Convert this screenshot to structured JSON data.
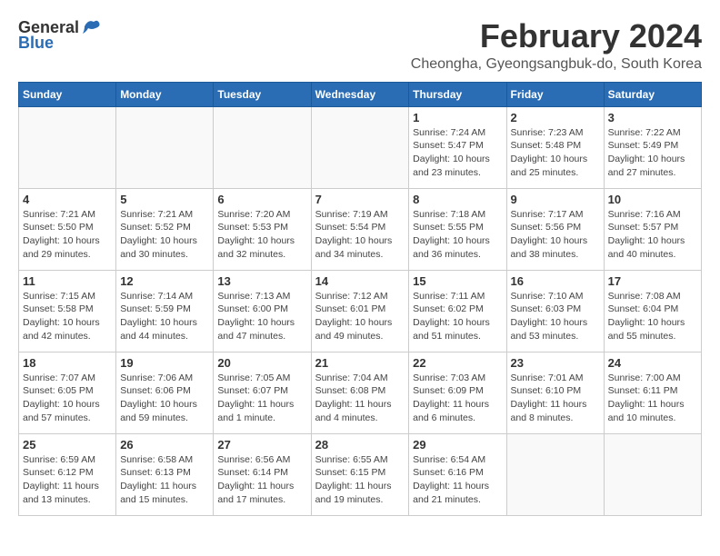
{
  "logo": {
    "general": "General",
    "blue": "Blue"
  },
  "title": {
    "month_year": "February 2024",
    "location": "Cheongha, Gyeongsangbuk-do, South Korea"
  },
  "days_of_week": [
    "Sunday",
    "Monday",
    "Tuesday",
    "Wednesday",
    "Thursday",
    "Friday",
    "Saturday"
  ],
  "weeks": [
    [
      {
        "day": "",
        "info": ""
      },
      {
        "day": "",
        "info": ""
      },
      {
        "day": "",
        "info": ""
      },
      {
        "day": "",
        "info": ""
      },
      {
        "day": "1",
        "info": "Sunrise: 7:24 AM\nSunset: 5:47 PM\nDaylight: 10 hours\nand 23 minutes."
      },
      {
        "day": "2",
        "info": "Sunrise: 7:23 AM\nSunset: 5:48 PM\nDaylight: 10 hours\nand 25 minutes."
      },
      {
        "day": "3",
        "info": "Sunrise: 7:22 AM\nSunset: 5:49 PM\nDaylight: 10 hours\nand 27 minutes."
      }
    ],
    [
      {
        "day": "4",
        "info": "Sunrise: 7:21 AM\nSunset: 5:50 PM\nDaylight: 10 hours\nand 29 minutes."
      },
      {
        "day": "5",
        "info": "Sunrise: 7:21 AM\nSunset: 5:52 PM\nDaylight: 10 hours\nand 30 minutes."
      },
      {
        "day": "6",
        "info": "Sunrise: 7:20 AM\nSunset: 5:53 PM\nDaylight: 10 hours\nand 32 minutes."
      },
      {
        "day": "7",
        "info": "Sunrise: 7:19 AM\nSunset: 5:54 PM\nDaylight: 10 hours\nand 34 minutes."
      },
      {
        "day": "8",
        "info": "Sunrise: 7:18 AM\nSunset: 5:55 PM\nDaylight: 10 hours\nand 36 minutes."
      },
      {
        "day": "9",
        "info": "Sunrise: 7:17 AM\nSunset: 5:56 PM\nDaylight: 10 hours\nand 38 minutes."
      },
      {
        "day": "10",
        "info": "Sunrise: 7:16 AM\nSunset: 5:57 PM\nDaylight: 10 hours\nand 40 minutes."
      }
    ],
    [
      {
        "day": "11",
        "info": "Sunrise: 7:15 AM\nSunset: 5:58 PM\nDaylight: 10 hours\nand 42 minutes."
      },
      {
        "day": "12",
        "info": "Sunrise: 7:14 AM\nSunset: 5:59 PM\nDaylight: 10 hours\nand 44 minutes."
      },
      {
        "day": "13",
        "info": "Sunrise: 7:13 AM\nSunset: 6:00 PM\nDaylight: 10 hours\nand 47 minutes."
      },
      {
        "day": "14",
        "info": "Sunrise: 7:12 AM\nSunset: 6:01 PM\nDaylight: 10 hours\nand 49 minutes."
      },
      {
        "day": "15",
        "info": "Sunrise: 7:11 AM\nSunset: 6:02 PM\nDaylight: 10 hours\nand 51 minutes."
      },
      {
        "day": "16",
        "info": "Sunrise: 7:10 AM\nSunset: 6:03 PM\nDaylight: 10 hours\nand 53 minutes."
      },
      {
        "day": "17",
        "info": "Sunrise: 7:08 AM\nSunset: 6:04 PM\nDaylight: 10 hours\nand 55 minutes."
      }
    ],
    [
      {
        "day": "18",
        "info": "Sunrise: 7:07 AM\nSunset: 6:05 PM\nDaylight: 10 hours\nand 57 minutes."
      },
      {
        "day": "19",
        "info": "Sunrise: 7:06 AM\nSunset: 6:06 PM\nDaylight: 10 hours\nand 59 minutes."
      },
      {
        "day": "20",
        "info": "Sunrise: 7:05 AM\nSunset: 6:07 PM\nDaylight: 11 hours\nand 1 minute."
      },
      {
        "day": "21",
        "info": "Sunrise: 7:04 AM\nSunset: 6:08 PM\nDaylight: 11 hours\nand 4 minutes."
      },
      {
        "day": "22",
        "info": "Sunrise: 7:03 AM\nSunset: 6:09 PM\nDaylight: 11 hours\nand 6 minutes."
      },
      {
        "day": "23",
        "info": "Sunrise: 7:01 AM\nSunset: 6:10 PM\nDaylight: 11 hours\nand 8 minutes."
      },
      {
        "day": "24",
        "info": "Sunrise: 7:00 AM\nSunset: 6:11 PM\nDaylight: 11 hours\nand 10 minutes."
      }
    ],
    [
      {
        "day": "25",
        "info": "Sunrise: 6:59 AM\nSunset: 6:12 PM\nDaylight: 11 hours\nand 13 minutes."
      },
      {
        "day": "26",
        "info": "Sunrise: 6:58 AM\nSunset: 6:13 PM\nDaylight: 11 hours\nand 15 minutes."
      },
      {
        "day": "27",
        "info": "Sunrise: 6:56 AM\nSunset: 6:14 PM\nDaylight: 11 hours\nand 17 minutes."
      },
      {
        "day": "28",
        "info": "Sunrise: 6:55 AM\nSunset: 6:15 PM\nDaylight: 11 hours\nand 19 minutes."
      },
      {
        "day": "29",
        "info": "Sunrise: 6:54 AM\nSunset: 6:16 PM\nDaylight: 11 hours\nand 21 minutes."
      },
      {
        "day": "",
        "info": ""
      },
      {
        "day": "",
        "info": ""
      }
    ]
  ]
}
